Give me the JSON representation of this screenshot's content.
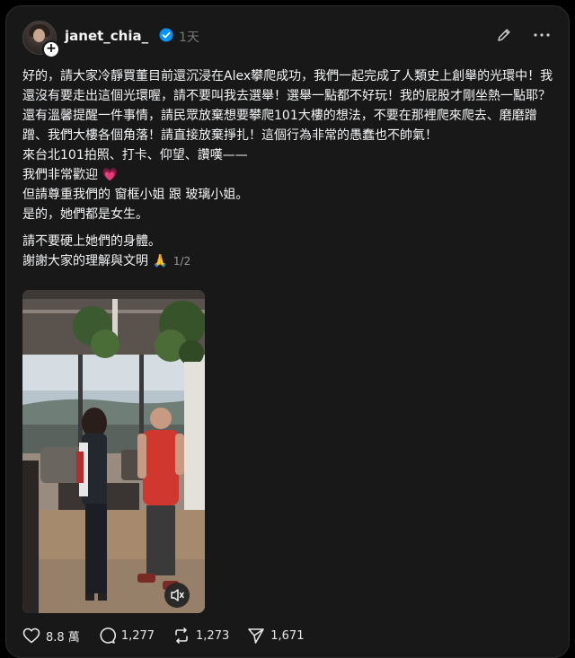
{
  "post": {
    "username": "janet_chia_",
    "time": "1天",
    "paragraphs": [
      "好的，請大家冷靜買董目前還沉浸在Alex攀爬成功，我們一起完成了人類史上創舉的光環中！我還沒有要走出這個光環喔，請不要叫我去選舉！選舉一點都不好玩！我的屁股才剛坐熱一點耶？",
      "還有溫馨提醒一件事情，請民眾放棄想要攀爬101大樓的想法，不要在那裡爬來爬去、磨磨蹭蹭、我們大樓各個角落！請直接放棄掙扎！這個行為非常的愚蠢也不帥氣！",
      "來台北101拍照、打卡、仰望、讚嘆——",
      "我們非常歡迎",
      "但請尊重我們的 窗框小姐 跟 玻璃小姐。",
      "是的，她們都是女生。"
    ],
    "heart_emoji": "💗",
    "paragraphs2": [
      "請不要硬上她們的身體。",
      "謝謝大家的理解與文明"
    ],
    "pray_emoji": "🙏",
    "pager": "1/2"
  },
  "stats": {
    "likes": "8.8 萬",
    "comments": "1,277",
    "reposts": "1,273",
    "shares": "1,671"
  },
  "icons": [
    "avatar",
    "plus-icon",
    "verified-icon",
    "edit-icon",
    "more-icon",
    "mute-icon",
    "heart-icon",
    "comment-icon",
    "repost-icon",
    "share-icon"
  ],
  "colors": {
    "background": "#000000",
    "card": "#181818",
    "verified": "#0095f6",
    "muted_text": "#777777"
  }
}
